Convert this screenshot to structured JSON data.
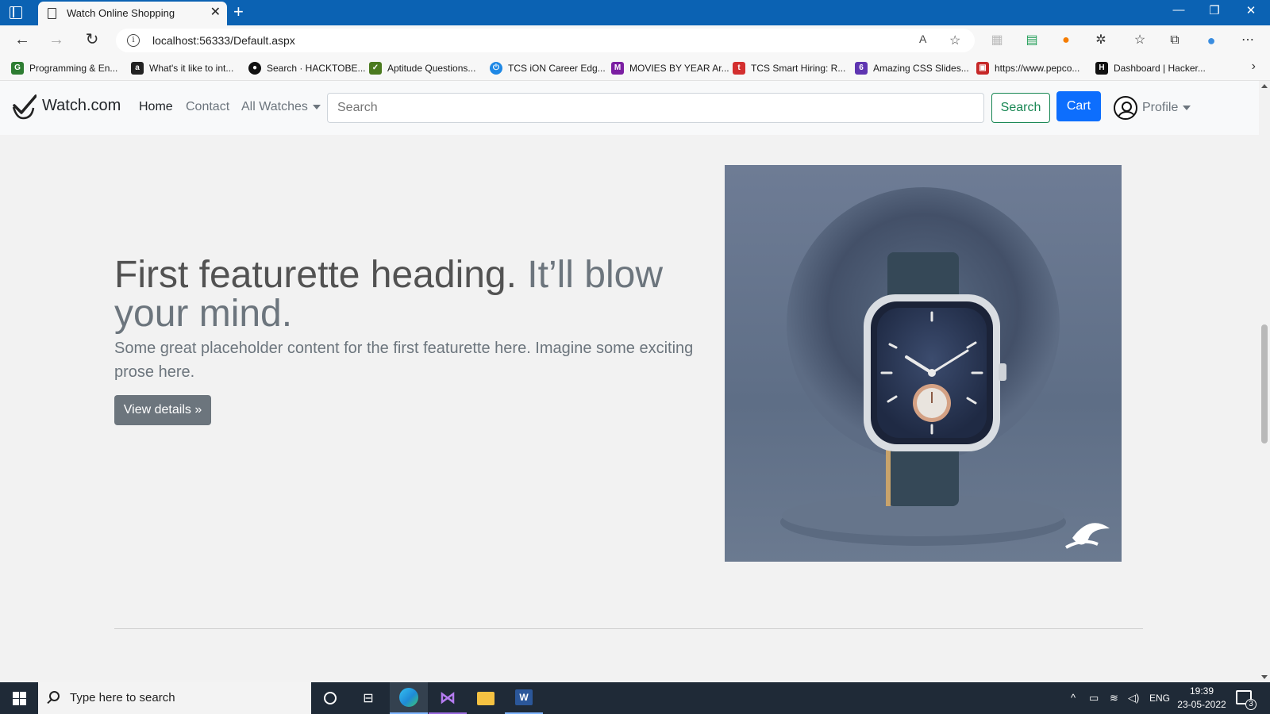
{
  "browser": {
    "tab_title": "Watch Online Shopping",
    "tab_close": "✕",
    "new_tab": "+",
    "url": "localhost:56333/Default.aspx",
    "window_controls": [
      "—",
      "❐",
      "✕"
    ]
  },
  "bookmarks": [
    {
      "label": "Programming & En...",
      "icon": "gfg-icon",
      "color": "#2e7d32"
    },
    {
      "label": "What's it like to int...",
      "icon": "a-icon",
      "color": "#222222"
    },
    {
      "label": "Search · HACKTOBE...",
      "icon": "github-icon",
      "color": "#111111"
    },
    {
      "label": "Aptitude Questions...",
      "icon": "indiabix-icon",
      "color": "#4b7a1f"
    },
    {
      "label": "TCS iON Career Edg...",
      "icon": "power-icon",
      "color": "#1e88e5"
    },
    {
      "label": "MOVIES BY YEAR Ar...",
      "icon": "m-icon",
      "color": "#7b1fa2"
    },
    {
      "label": "TCS Smart Hiring: R...",
      "icon": "tcs-icon",
      "color": "#d32f2f"
    },
    {
      "label": "Amazing CSS Slides...",
      "icon": "six-icon",
      "color": "#5e35b1"
    },
    {
      "label": "https://www.pepco...",
      "icon": "box-icon",
      "color": "#c62828"
    },
    {
      "label": "Dashboard | Hacker...",
      "icon": "hackerrank-icon",
      "color": "#111111"
    }
  ],
  "navbar": {
    "brand": "Watch.com",
    "links": [
      "Home",
      "Contact",
      "All Watches"
    ],
    "search_placeholder": "Search",
    "search_button": "Search",
    "cart_button": "Cart",
    "profile": "Profile"
  },
  "featurette": {
    "heading": "First featurette heading.",
    "heading_muted": "It’ll blow your mind.",
    "lead": "Some great placeholder content for the first featurette here. Imagine some exciting prose here.",
    "button": "View details »",
    "image_alt": "watch-image"
  },
  "taskbar": {
    "search_placeholder": "Type here to search",
    "lang": "ENG",
    "time": "19:39",
    "date": "23-05-2022",
    "notifications": "3"
  },
  "colors": {
    "primary": "#0d6efd",
    "success": "#198754",
    "secondary": "#6c757d",
    "browser_blue": "#0b62b3"
  }
}
